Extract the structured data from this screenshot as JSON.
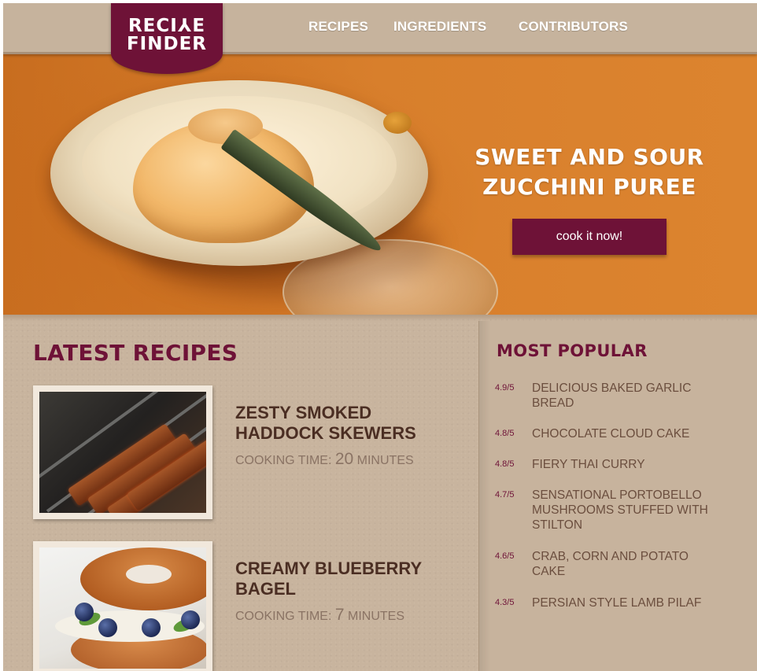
{
  "header": {
    "logo_line1": "RECI⅄E",
    "logo_line2": "FINDER",
    "nav": [
      "RECIPES",
      "INGREDIENTS",
      "CONTRIBUTORS"
    ]
  },
  "hero": {
    "title_line1": "SWEET AND SOUR",
    "title_line2": "ZUCCHINI PUREE",
    "button_label": "cook it now!"
  },
  "latest": {
    "heading": "LATEST RECIPES",
    "cooking_time_prefix": "COOKING TIME:",
    "minutes_label": "MINUTES",
    "items": [
      {
        "name_line1": "ZESTY SMOKED",
        "name_line2": "HADDOCK SKEWERS",
        "minutes": "20"
      },
      {
        "name_line1": "CREAMY BLUEBERRY",
        "name_line2": "BAGEL",
        "minutes": "7"
      }
    ]
  },
  "popular": {
    "heading": "MOST POPULAR",
    "items": [
      {
        "rating": "4.9/5",
        "name": "DELICIOUS BAKED GARLIC BREAD"
      },
      {
        "rating": "4.8/5",
        "name": "CHOCOLATE CLOUD CAKE"
      },
      {
        "rating": "4.8/5",
        "name": "FIERY THAI CURRY"
      },
      {
        "rating": "4.7/5",
        "name": "SENSATIONAL PORTOBELLO MUSHROOMS STUFFED WITH STILTON"
      },
      {
        "rating": "4.6/5",
        "name": "CRAB, CORN AND POTATO CAKE"
      },
      {
        "rating": "4.3/5",
        "name": "PERSIAN STYLE LAMB PILAF"
      }
    ]
  },
  "colors": {
    "brand": "#6e1237",
    "hero_orange": "#d87f2c",
    "background": "#c8b49e"
  }
}
